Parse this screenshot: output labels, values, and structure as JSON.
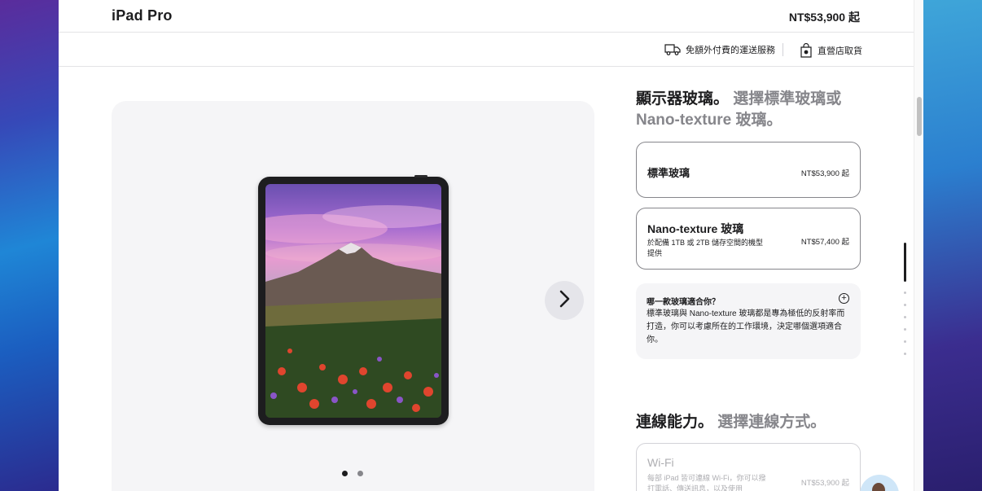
{
  "header": {
    "product_title": "iPad Pro",
    "starting_price": "NT$53,900 起"
  },
  "services": {
    "shipping": "免額外付費的運送服務",
    "store_pickup": "直營店取貨"
  },
  "gallery": {
    "page_count": 2,
    "active_page": 1
  },
  "glass_section": {
    "heading": "顯示器玻璃。",
    "heading_muted": "選擇標準玻璃或 Nano-texture 玻璃。",
    "options": [
      {
        "name": "標準玻璃",
        "note": "",
        "price": "NT$53,900 起"
      },
      {
        "name": "Nano-texture 玻璃",
        "note": "於配備 1TB 或 2TB 儲存空間的機型提供",
        "price": "NT$57,400 起"
      }
    ],
    "help": {
      "title": "哪一款玻璃適合你？",
      "body": "標準玻璃與 Nano-texture 玻璃都是專為極低的反射率而打造，你可以考慮所在的工作環境，決定哪個選項適合你。"
    }
  },
  "connectivity_section": {
    "heading": "連線能力。",
    "heading_muted": "選擇連線方式。",
    "options": [
      {
        "name": "Wi‑Fi",
        "note": "每部 iPad 皆可連線 Wi‑Fi，你可以撥打電話、傳送訊息，以及使用",
        "price": "NT$53,900 起"
      }
    ]
  },
  "colors": {
    "text": "#1d1d1f",
    "muted": "#86868b",
    "panel": "#f5f5f7"
  }
}
